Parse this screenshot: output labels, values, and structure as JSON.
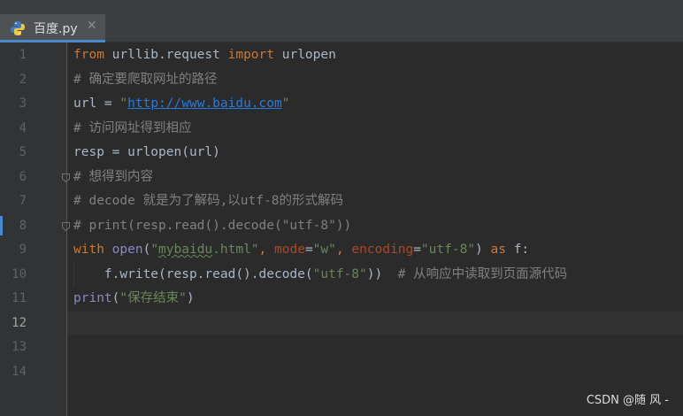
{
  "tab": {
    "filename": "百度.py",
    "close_glyph": "✕",
    "icon": "python-file-icon"
  },
  "editor": {
    "current_line": 12,
    "line_numbers": [
      "1",
      "2",
      "3",
      "4",
      "5",
      "6",
      "7",
      "8",
      "9",
      "10",
      "11",
      "12",
      "13",
      "14"
    ],
    "lines": [
      [
        {
          "t": "from",
          "c": "kw"
        },
        {
          "t": " urllib.request ",
          "c": ""
        },
        {
          "t": "import",
          "c": "kw"
        },
        {
          "t": " urlopen",
          "c": ""
        }
      ],
      [
        {
          "t": "# 确定要爬取网址的路径",
          "c": "cm"
        }
      ],
      [
        {
          "t": "url = ",
          "c": ""
        },
        {
          "t": "\"",
          "c": "str"
        },
        {
          "t": "http://www.baidu.com",
          "c": "url"
        },
        {
          "t": "\"",
          "c": "str"
        }
      ],
      [
        {
          "t": "# 访问网址得到相应",
          "c": "cm"
        }
      ],
      [
        {
          "t": "resp = urlopen(url)",
          "c": ""
        }
      ],
      [
        {
          "t": "# 想得到内容",
          "c": "cm"
        }
      ],
      [
        {
          "t": "# decode 就是为了解码,以utf-8的形式解码",
          "c": "cm"
        }
      ],
      [
        {
          "t": "# print(resp.read().decode(\"utf-8\"))",
          "c": "cm"
        }
      ],
      [
        {
          "t": "with",
          "c": "kw"
        },
        {
          "t": " ",
          "c": ""
        },
        {
          "t": "open",
          "c": "bi"
        },
        {
          "t": "(",
          "c": ""
        },
        {
          "t": "\"",
          "c": "str"
        },
        {
          "t": "mybaidu",
          "c": "str squig"
        },
        {
          "t": ".html\"",
          "c": "str"
        },
        {
          "t": ", ",
          "c": "kw"
        },
        {
          "t": "mode",
          "c": "pn"
        },
        {
          "t": "=",
          "c": ""
        },
        {
          "t": "\"w\"",
          "c": "str"
        },
        {
          "t": ", ",
          "c": "kw"
        },
        {
          "t": "encoding",
          "c": "pn"
        },
        {
          "t": "=",
          "c": ""
        },
        {
          "t": "\"utf-8\"",
          "c": "str"
        },
        {
          "t": ") ",
          "c": ""
        },
        {
          "t": "as",
          "c": "kw"
        },
        {
          "t": " f:",
          "c": ""
        }
      ],
      [
        {
          "t": "    f.write(resp.read().decode(",
          "c": ""
        },
        {
          "t": "\"utf-8\"",
          "c": "str"
        },
        {
          "t": "))  ",
          "c": ""
        },
        {
          "t": "# 从响应中读取到页面源代码",
          "c": "cm"
        }
      ],
      [
        {
          "t": "print",
          "c": "bi"
        },
        {
          "t": "(",
          "c": ""
        },
        {
          "t": "\"保存结束\"",
          "c": "str"
        },
        {
          "t": ")",
          "c": ""
        }
      ],
      [],
      [],
      []
    ]
  },
  "watermark": "CSDN @随 风 -"
}
